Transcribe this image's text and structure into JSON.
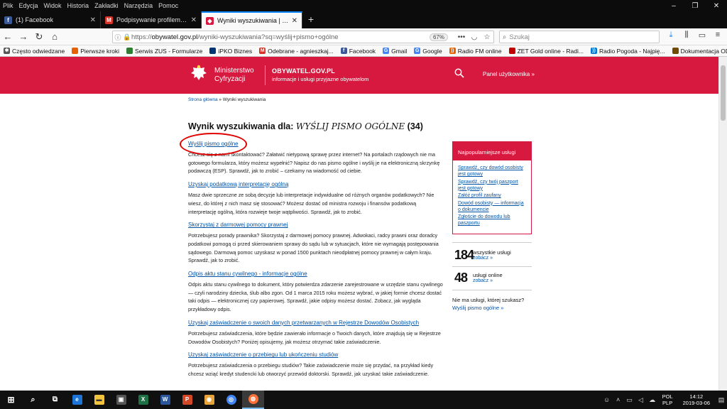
{
  "menubar": {
    "items": [
      "Plik",
      "Edycja",
      "Widok",
      "Historia",
      "Zakładki",
      "Narzędzia",
      "Pomoc"
    ]
  },
  "tabs": [
    {
      "label": "(1) Facebook",
      "icon": "facebook-icon",
      "color": "#3b5998"
    },
    {
      "label": "Podpisywanie profilem zaufanego",
      "icon": "gmail-icon",
      "color": "#d93025"
    },
    {
      "label": "Wyniki wyszukiwania | obywatel",
      "icon": "gov-favicon-icon",
      "color": "#d7193f"
    }
  ],
  "urlbar": {
    "prefix": "https://",
    "domain": "obywatel.gov.pl",
    "path": "/wyniki-wyszukiwania?sq=wyślij+pismo+ogólne",
    "zoom": "67%"
  },
  "search": {
    "placeholder": "Szukaj"
  },
  "bookmarks": [
    {
      "label": "Często odwiedzane",
      "color": "#555555"
    },
    {
      "label": "Pierwsze kroki",
      "color": "#e66000"
    },
    {
      "label": "Serwis ZUS - Formularze",
      "color": "#2f7d32"
    },
    {
      "label": "iPKO Biznes",
      "color": "#003574"
    },
    {
      "label": "Odebrane - agnieszkaj...",
      "color": "#d93025"
    },
    {
      "label": "Facebook",
      "color": "#3b5998"
    },
    {
      "label": "Gmail",
      "color": "#d93025"
    },
    {
      "label": "Google",
      "color": "#4285f4"
    },
    {
      "label": "Radio FM online",
      "color": "#e66000"
    },
    {
      "label": "ZET Gold online - Radi...",
      "color": "#c00000"
    },
    {
      "label": "Radio Pogoda - Najpię...",
      "color": "#0078d4"
    },
    {
      "label": "Dokumentacja ODO - ...",
      "color": "#6d4c00"
    }
  ],
  "header": {
    "ministry_line1": "Ministerstwo",
    "ministry_line2": "Cyfryzacji",
    "portal": "OBYWATEL.GOV.PL",
    "tagline": "informacje i usługi przyjazne obywatelom",
    "user_panel": "Panel użytkownika »"
  },
  "breadcrumb": {
    "home": "Strona główna",
    "sep": " » ",
    "current": "Wyniki wyszukiwania"
  },
  "heading": {
    "prefix": "Wynik wyszukiwania dla: ",
    "query": "WYŚLIJ PISMO OGÓLNE",
    "count": " (34)"
  },
  "results": [
    {
      "title": "Wyślij pismo ogólne",
      "desc": "Chcesz się z nami skontaktować? Załatwić nietypową sprawę przez internet? Na portalach rządowych nie ma gotowego formularza, który możesz wypełnić? Napisz do nas pismo ogólne i wyślij je na elektroniczną skrzynkę podawczą (ESP). Sprawdź, jak to zrobić – czekamy na wiadomość od ciebie."
    },
    {
      "title": "Uzyskaj podatkową interpretację ogólną",
      "desc": "Masz dwie sprzeczne ze sobą decyzje lub interpretacje indywidualne od różnych organów podatkowych? Nie wiesz, do której z nich masz się stosować? Możesz dostać od ministra rozwoju i finansów podatkową interpretację ogólną, która rozwieje twoje wątpliwości. Sprawdź, jak to zrobić."
    },
    {
      "title": "Skorzystaj z darmowej pomocy prawnej",
      "desc": "Potrzebujesz porady prawnika? Skorzystaj z darmowej pomocy prawnej. Adwokaci, radcy prawni oraz doradcy podatkowi pomogą ci przed skierowaniem sprawy do sądu lub w sytuacjach, które nie wymagają postępowania sądowego. Darmową pomoc uzyskasz w ponad 1500 punktach nieodpłatnej pomocy prawnej w całym kraju. Sprawdź, jak to zrobić."
    },
    {
      "title": "Odpis aktu stanu cywilnego - informacje ogólne",
      "desc": "Odpis aktu stanu cywilnego to dokument, który potwierdza zdarzenie zarejestrowane w urzędzie stanu cywilnego — czyli narodziny dziecka, ślub albo zgon. Od 1 marca 2015 roku możesz wybrać, w jakiej formie chcesz dostać taki odpis — elektronicznej czy papierowej. Sprawdź, jakie odpisy możesz dostać. Zobacz, jak wygląda przykładowy odpis."
    },
    {
      "title": "Uzyskaj zaświadczenie o swoich danych przetwarzanych w Rejestrze Dowodów Osobistych",
      "desc": "Potrzebujesz zaświadczenia, które będzie zawierało informacje o Twoich danych, które znajdują się w Rejestrze Dowodów Osobistych? Poniżej opisujemy, jak możesz otrzymać takie zaświadczenie."
    },
    {
      "title": "Uzyskaj zaświadczenie o przebiegu lub ukończeniu studiów",
      "desc": "Potrzebujesz zaświadczenia o przebiegu studiów? Takie zaświadczenie może się przydać, na przykład kiedy chcesz wziąć kredyt studencki lub otworzyć przewód doktorski. Sprawdź, jak uzyskać takie zaświadczenie."
    }
  ],
  "popular": {
    "title": "Najpopularniejsze usługi",
    "items": [
      "Sprawdź, czy dowód osobisty jest gotowy",
      "Sprawdź, czy twój paszport jest gotowy",
      "Załóż profil zaufany",
      "Dowód osobisty — informacja o dokumencie",
      "Zgłoście do dowodu lub paszportu"
    ]
  },
  "stats": [
    {
      "num": "184",
      "label": "wszystkie usługi",
      "more": "zobacz »"
    },
    {
      "num": "48",
      "label": "usługi online",
      "more": "zobacz »"
    }
  ],
  "notfound": {
    "question": "Nie ma usługi, której szukasz?",
    "link": "Wyślij pismo ogólne »"
  },
  "taskbar": {
    "lang1": "POL",
    "lang2": "PLP",
    "time": "14:12",
    "date": "2019-03-06",
    "apps": [
      {
        "icon": "windows-start-icon",
        "color": "#ffffff",
        "glyph": "⊞"
      },
      {
        "icon": "search-icon",
        "color": "#101010",
        "glyph": "⌕"
      },
      {
        "icon": "task-view-icon",
        "color": "#101010",
        "glyph": "⧉"
      },
      {
        "icon": "edge-icon",
        "color": "#1e74d6",
        "glyph": "e"
      },
      {
        "icon": "file-explorer-icon",
        "color": "#f2c33c",
        "glyph": "▬"
      },
      {
        "icon": "store-icon",
        "color": "#555555",
        "glyph": "▣"
      },
      {
        "icon": "excel-icon",
        "color": "#1e7145",
        "glyph": "X"
      },
      {
        "icon": "word-icon",
        "color": "#2b579a",
        "glyph": "W"
      },
      {
        "icon": "powerpoint-icon",
        "color": "#d24726",
        "glyph": "P"
      },
      {
        "icon": "paint-icon",
        "color": "#e8a33a",
        "glyph": "◉"
      },
      {
        "icon": "chrome-icon",
        "color": "#4285f4",
        "glyph": "◎"
      },
      {
        "icon": "firefox-icon",
        "color": "#ff7139",
        "glyph": "◍"
      }
    ]
  }
}
